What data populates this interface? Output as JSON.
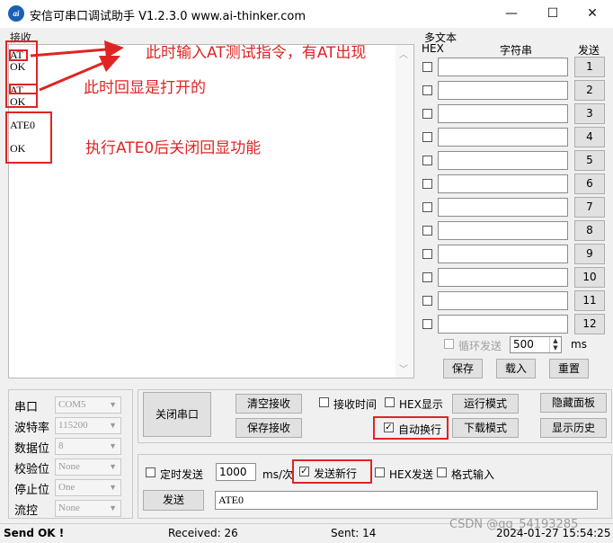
{
  "window": {
    "title": "安信可串口调试助手 V1.2.3.0    www.ai-thinker.com",
    "icon_text": "ai",
    "minimize": "—",
    "maximize": "☐",
    "close": "✕"
  },
  "receive": {
    "label": "接收",
    "lines": [
      "AT",
      "OK",
      "AT",
      "OK",
      "ATE0",
      "OK"
    ]
  },
  "annotations": {
    "a1": "此时输入AT测试指令，有AT出现",
    "a2": "此时回显是打开的",
    "a3": "执行ATE0后关闭回显功能",
    "color": "#e02424"
  },
  "multi_text": {
    "title": "多文本",
    "hex_header": "HEX",
    "string_header": "字符串",
    "send_header": "发送",
    "rows": [
      {
        "n": "1"
      },
      {
        "n": "2"
      },
      {
        "n": "3"
      },
      {
        "n": "4"
      },
      {
        "n": "5"
      },
      {
        "n": "6"
      },
      {
        "n": "7"
      },
      {
        "n": "8"
      },
      {
        "n": "9"
      },
      {
        "n": "10"
      },
      {
        "n": "11"
      },
      {
        "n": "12"
      }
    ],
    "loop_send_label": "循环发送",
    "loop_interval": "500",
    "loop_unit": "ms",
    "save": "保存",
    "load": "载入",
    "reset": "重置"
  },
  "serial": {
    "port_label": "串口",
    "port_value": "COM5",
    "baud_label": "波特率",
    "baud_value": "115200",
    "data_label": "数据位",
    "data_value": "8",
    "parity_label": "校验位",
    "parity_value": "None",
    "stop_label": "停止位",
    "stop_value": "One",
    "flow_label": "流控",
    "flow_value": "None"
  },
  "controls": {
    "close_port": "关闭串口",
    "clear_recv": "清空接收",
    "save_recv": "保存接收",
    "recv_time": "接收时间",
    "hex_display": "HEX显示",
    "run_mode": "运行模式",
    "hide_panel": "隐藏面板",
    "auto_wrap": "自动换行",
    "download_mode": "下载模式",
    "show_history": "显示历史"
  },
  "send": {
    "timed_send": "定时发送",
    "interval": "1000",
    "unit": "ms/次",
    "send_newline": "发送新行",
    "hex_send": "HEX发送",
    "format_input": "格式输入",
    "send_button": "发送",
    "input_value": "ATE0"
  },
  "status": {
    "send_ok": "Send OK !",
    "received": "Received: 26",
    "sent": "Sent: 14",
    "datetime": "2024-01-27 15:54:25",
    "watermark": "CSDN @qq_54193285"
  }
}
